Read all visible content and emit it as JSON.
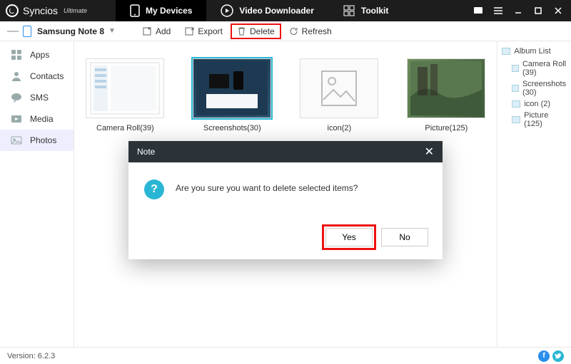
{
  "app": {
    "name": "Syncios",
    "edition": "Ultimate"
  },
  "nav": {
    "devices": "My Devices",
    "video": "Video Downloader",
    "toolkit": "Toolkit"
  },
  "device": {
    "name": "Samsung Note 8"
  },
  "toolbar": {
    "add": "Add",
    "export": "Export",
    "delete": "Delete",
    "refresh": "Refresh"
  },
  "sidebar": {
    "apps": "Apps",
    "contacts": "Contacts",
    "sms": "SMS",
    "media": "Media",
    "photos": "Photos"
  },
  "albums": [
    {
      "label": "Camera Roll(39)"
    },
    {
      "label": "Screenshots(30)"
    },
    {
      "label": "icon(2)"
    },
    {
      "label": "Picture(125)"
    }
  ],
  "album_panel": {
    "title": "Album List",
    "camera": "Camera Roll (39)",
    "screenshots": "Screenshots (30)",
    "icon": "icon (2)",
    "picture": "Picture (125)"
  },
  "modal": {
    "title": "Note",
    "message": "Are you sure you want to delete selected items?",
    "yes": "Yes",
    "no": "No"
  },
  "footer": {
    "version": "Version: 6.2.3"
  }
}
